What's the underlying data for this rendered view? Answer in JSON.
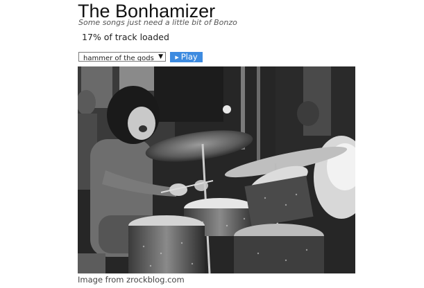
{
  "header": {
    "title": "The Bonhamizer",
    "subtitle": "Some songs just need a little bit of Bonzo"
  },
  "status": {
    "loaded_text": "17% of track loaded",
    "loaded_percent": 17
  },
  "controls": {
    "track_select_value": "hammer of the gods",
    "play_label": "Play",
    "play_icon": "play-triangle-icon"
  },
  "image": {
    "credit": "Image from zrockblog.com"
  },
  "colors": {
    "play_button": "#3d8be0",
    "play_text": "#ffffff"
  }
}
